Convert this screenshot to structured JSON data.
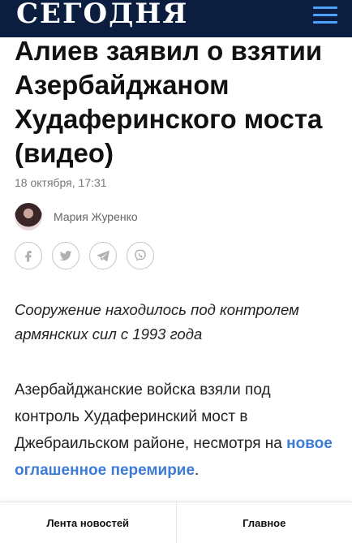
{
  "header": {
    "logo": "СЕГОДНЯ",
    "menu_icon": "hamburger-menu-icon"
  },
  "article": {
    "title": "Алиев заявил о взятии Азербайджаном Худаферинского моста (видео)",
    "date": "18 октября, 17:31",
    "author": {
      "name": "Мария Журенко"
    },
    "share_icons": [
      "facebook-icon",
      "twitter-icon",
      "telegram-icon",
      "viber-icon"
    ],
    "lead": "Сооружение находилось под контролем армянских сил с 1993 года",
    "body": {
      "text": "Азербайджанские войска взяли под контроль Худаферинский мост в Джебраильском районе, несмотря на ",
      "link_text": "новое оглашенное перемирие",
      "end": "."
    }
  },
  "bottom_nav": {
    "feed_label": "Лента новостей",
    "main_label": "Главное"
  },
  "colors": {
    "header_bg": "#0c1e3f",
    "accent": "#4aa3ff",
    "link": "#3d7bd6"
  }
}
